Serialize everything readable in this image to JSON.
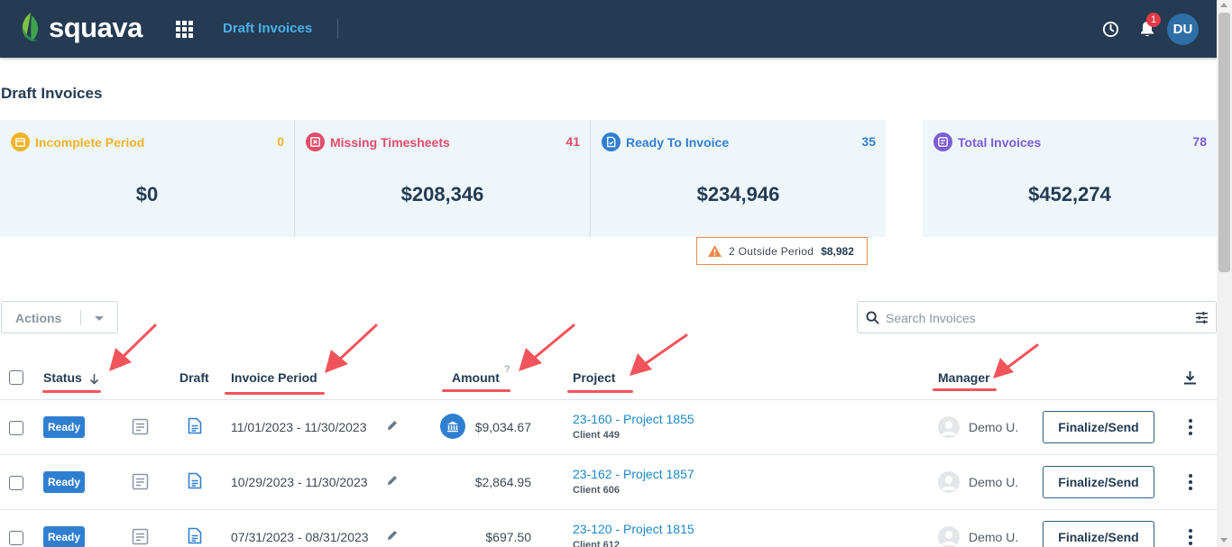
{
  "app": {
    "brand": "squava",
    "current_page": "Draft Invoices",
    "avatar_initials": "DU",
    "notification_count": "1"
  },
  "page": {
    "title": "Draft Invoices"
  },
  "cards": [
    {
      "label": "Incomplete Period",
      "count": "0",
      "amount": "$0",
      "color": "#f0b429",
      "icon": "calendar-icon"
    },
    {
      "label": "Missing Timesheets",
      "count": "41",
      "amount": "$208,346",
      "color": "#e14d6a",
      "icon": "timesheet-icon"
    },
    {
      "label": "Ready To Invoice",
      "count": "35",
      "amount": "$234,946",
      "color": "#2f7fd1",
      "icon": "invoice-check-icon"
    },
    {
      "label": "Total Invoices",
      "count": "78",
      "amount": "$452,274",
      "color": "#7b5cd6",
      "icon": "invoices-icon"
    }
  ],
  "outside_period": {
    "text": "2 Outside Period",
    "amount": "$8,982"
  },
  "toolbar": {
    "actions_label": "Actions",
    "search_placeholder": "Search Invoices"
  },
  "table": {
    "headers": {
      "status": "Status",
      "draft": "Draft",
      "invoice_period": "Invoice Period",
      "amount": "Amount",
      "amount_help": "?",
      "project": "Project",
      "manager": "Manager"
    },
    "rows": [
      {
        "status": "Ready",
        "period": "11/01/2023 - 11/30/2023",
        "amount": "$9,034.67",
        "has_bank_icon": true,
        "project": "23-160 - Project 1855",
        "client": "Client 449",
        "manager": "Demo U.",
        "action": "Finalize/Send"
      },
      {
        "status": "Ready",
        "period": "10/29/2023 - 11/30/2023",
        "amount": "$2,864.95",
        "has_bank_icon": false,
        "project": "23-162 - Project 1857",
        "client": "Client 606",
        "manager": "Demo U.",
        "action": "Finalize/Send"
      },
      {
        "status": "Ready",
        "period": "07/31/2023 - 08/31/2023",
        "amount": "$697.50",
        "has_bank_icon": false,
        "project": "23-120 - Project 1815",
        "client": "Client 612",
        "manager": "Demo U.",
        "action": "Finalize/Send"
      }
    ]
  }
}
